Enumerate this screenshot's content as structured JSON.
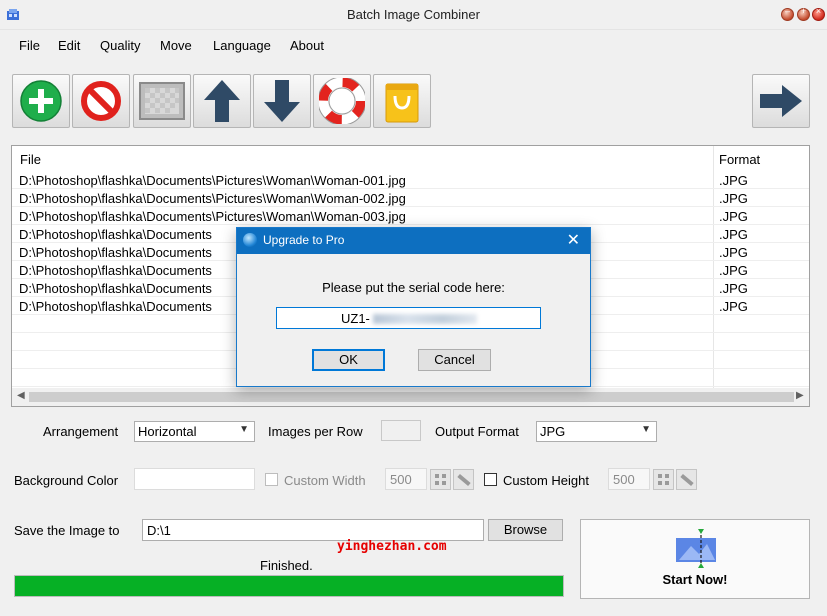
{
  "window": {
    "title": "Batch Image Combiner",
    "icon": "app-icon"
  },
  "menu": [
    "File",
    "Edit",
    "Quality",
    "Move",
    "Language",
    "About"
  ],
  "toolbar": {
    "buttons": [
      "add-icon",
      "remove-icon",
      "clear-icon",
      "move-up-icon",
      "move-down-icon",
      "help-icon",
      "shop-icon"
    ],
    "next": "next-arrow-icon"
  },
  "filelist": {
    "columns": {
      "file": "File",
      "format": "Format"
    },
    "rows": [
      {
        "file": "D:\\Photoshop\\flashka\\Documents\\Pictures\\Woman\\Woman-001.jpg",
        "format": ".JPG"
      },
      {
        "file": "D:\\Photoshop\\flashka\\Documents\\Pictures\\Woman\\Woman-002.jpg",
        "format": ".JPG"
      },
      {
        "file": "D:\\Photoshop\\flashka\\Documents\\Pictures\\Woman\\Woman-003.jpg",
        "format": ".JPG"
      },
      {
        "file": "D:\\Photoshop\\flashka\\Documents",
        "format": ".JPG"
      },
      {
        "file": "D:\\Photoshop\\flashka\\Documents",
        "format": ".JPG"
      },
      {
        "file": "D:\\Photoshop\\flashka\\Documents",
        "format": ".JPG"
      },
      {
        "file": "D:\\Photoshop\\flashka\\Documents",
        "format": ".JPG"
      },
      {
        "file": "D:\\Photoshop\\flashka\\Documents",
        "format": ".JPG"
      }
    ]
  },
  "options": {
    "arrangement_label": "Arrangement",
    "arrangement_value": "Horizontal",
    "images_per_row_label": "Images per Row",
    "images_per_row_value": "",
    "output_format_label": "Output Format",
    "output_format_value": "JPG",
    "background_color_label": "Background Color",
    "custom_width_label": "Custom Width",
    "custom_width_value": "500",
    "custom_height_label": "Custom Height",
    "custom_height_value": "500",
    "save_label": "Save the Image to",
    "save_path": "D:\\1",
    "browse_label": "Browse"
  },
  "status": {
    "text": "Finished.",
    "progress": 1.0,
    "progress_color": "#06b025"
  },
  "start": {
    "label": "Start Now!"
  },
  "watermark": "yinghezhan.com",
  "dialog": {
    "title": "Upgrade to Pro",
    "prompt": "Please put the serial code here:",
    "serial_prefix": "UZ1-",
    "ok": "OK",
    "cancel": "Cancel"
  },
  "colors": {
    "accent": "#0d6fc0",
    "progress": "#06b025"
  }
}
